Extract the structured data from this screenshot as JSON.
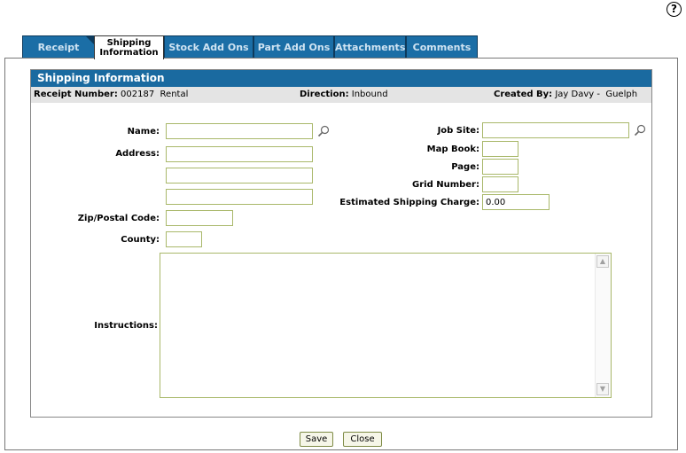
{
  "help": {
    "glyph": "?"
  },
  "tabs": [
    {
      "label": "Receipt"
    },
    {
      "label_line1": "Shipping",
      "label_line2": "Information"
    },
    {
      "label": "Stock Add Ons"
    },
    {
      "label": "Part Add Ons"
    },
    {
      "label": "Attachments"
    },
    {
      "label": "Comments"
    }
  ],
  "section": {
    "title": "Shipping Information"
  },
  "info": {
    "receipt_label": "Receipt Number:",
    "receipt_value": "002187  Rental",
    "direction_label": "Direction:",
    "direction_value": "Inbound",
    "created_label": "Created By:",
    "created_value": "Jay Davy -  Guelph"
  },
  "form": {
    "name_label": "Name:",
    "address_label": "Address:",
    "zip_label": "Zip/Postal Code:",
    "county_label": "County:",
    "instructions_label": "Instructions:",
    "jobsite_label": "Job Site:",
    "mapbook_label": "Map Book:",
    "page_label": "Page:",
    "grid_label": "Grid Number:",
    "shipcharge_label": "Estimated Shipping Charge:",
    "shipcharge_value": "0.00"
  },
  "buttons": {
    "save": "Save",
    "close": "Close"
  },
  "icons": {
    "lookup": "magnifier-icon",
    "help": "help-icon"
  }
}
